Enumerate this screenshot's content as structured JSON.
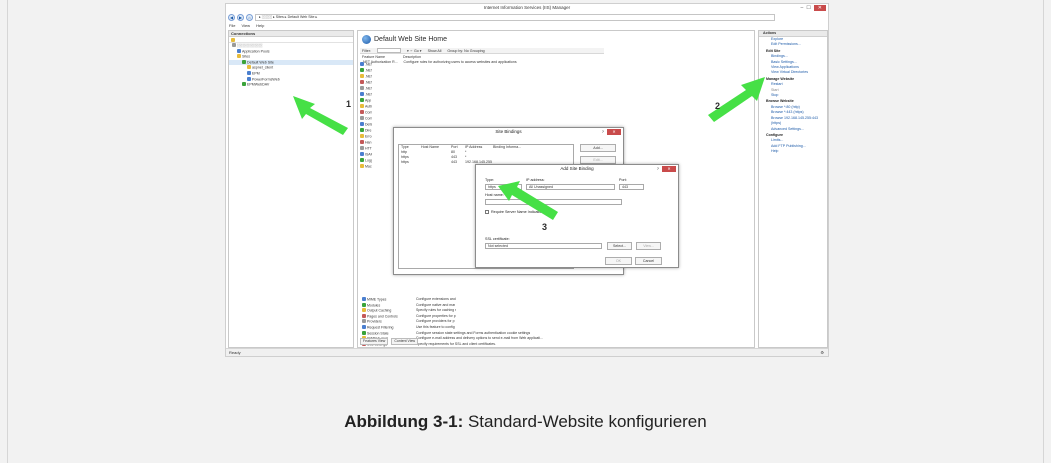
{
  "window": {
    "title": "Internet Information Services (IIS) Manager",
    "min": "‒",
    "max": "☐",
    "close": "✕"
  },
  "addressbar": {
    "path": "▸ ░░░░ ▸ Sites ▸ Default Web Site ▸"
  },
  "menu": {
    "items": [
      "File",
      "View",
      "Help"
    ]
  },
  "connections": {
    "header": "Connections",
    "tree": [
      {
        "label": "░░░░░░░░░░",
        "icon": "server-icon",
        "depth": 0
      },
      {
        "label": "Application Pools",
        "icon": "app-pool-icon",
        "depth": 1
      },
      {
        "label": "Sites",
        "icon": "folder-icon",
        "depth": 1
      },
      {
        "label": "Default Web Site",
        "icon": "globe-icon",
        "depth": 2
      },
      {
        "label": "aspnet_client",
        "icon": "folder-icon",
        "depth": 3
      },
      {
        "label": "EPM",
        "icon": "app-icon",
        "depth": 3
      },
      {
        "label": "PowerFormsWeb",
        "icon": "app-icon",
        "depth": 3
      },
      {
        "label": "EPMWebDAV",
        "icon": "globe-icon",
        "depth": 2
      }
    ]
  },
  "center": {
    "title": "Default Web Site Home",
    "filter_label": "Filter:",
    "go": "▾ ☞ Go ▾",
    "show_all": "Show All",
    "group_by": "Group by: No Grouping",
    "col_name": "Feature Name",
    "col_desc": "Description",
    "top_row_name": ".NET Authorization R...",
    "top_row_desc": "Configure rules for authorizing users to access websites and applications",
    "side_features": [
      ".NET",
      ".NET",
      ".NET",
      ".NET",
      ".NET",
      ".NET",
      "App",
      "Auth",
      "Com",
      "Com",
      "Defa",
      "Dire",
      "Erro",
      "Han",
      "HTT",
      "ISAP",
      "Logg",
      "Mac"
    ],
    "features": [
      {
        "name": "MIME Types",
        "desc": "Configure extensions and"
      },
      {
        "name": "Modules",
        "desc": "Configure native and mar"
      },
      {
        "name": "Output Caching",
        "desc": "Specify rules for caching r"
      },
      {
        "name": "Pages and Controls",
        "desc": "Configure properties for p"
      },
      {
        "name": "Providers",
        "desc": "Configure providers for p"
      },
      {
        "name": "Request Filtering",
        "desc": "Use this feature to config"
      },
      {
        "name": "Session State",
        "desc": "Configure session state settings and Forms authentication cookie settings"
      },
      {
        "name": "SMTP E-mail",
        "desc": "Configure e-mail address and delivery options to send e-mail from Web applicati..."
      },
      {
        "name": "SSL Settings",
        "desc": "Specify requirements for SSL and client certificates."
      }
    ],
    "tab_features": "Features View",
    "tab_content": "Content View"
  },
  "site_bindings": {
    "title": "Site Bindings",
    "help": "?",
    "close": "✕",
    "columns": [
      "Type",
      "Host Name",
      "Port",
      "IP Address",
      "Binding Informa..."
    ],
    "rows": [
      [
        "http",
        "",
        "80",
        "*",
        ""
      ],
      [
        "https",
        "",
        "443",
        "*",
        ""
      ],
      [
        "https",
        "",
        "443",
        "192.168.145.255",
        ""
      ]
    ],
    "btn_add": "Add...",
    "btn_edit": "Edit...",
    "btn_remove": "Remove",
    "btn_browse": "Browse"
  },
  "add_binding": {
    "title": "Add Site Binding",
    "help": "?",
    "close": "✕",
    "type_label": "Type:",
    "type_value": "https",
    "ip_label": "IP address:",
    "ip_value": "All Unassigned",
    "port_label": "Port:",
    "port_value": "443",
    "host_label": "Host name:",
    "host_value": "",
    "sni_label": "Require Server Name Indication",
    "ssl_label": "SSL certificate:",
    "ssl_value": "Not selected",
    "select": "Select...",
    "view": "View...",
    "ok": "OK",
    "cancel": "Cancel"
  },
  "actions": {
    "header": "Actions",
    "items": [
      {
        "text": "Explore",
        "kind": "lnk"
      },
      {
        "text": "Edit Permissions...",
        "kind": "lnk"
      },
      {
        "text": "Edit Site",
        "kind": "hdr"
      },
      {
        "text": "Bindings...",
        "kind": "lnk"
      },
      {
        "text": "Basic Settings...",
        "kind": "lnk"
      },
      {
        "text": "View Applications",
        "kind": "lnk"
      },
      {
        "text": "View Virtual Directories",
        "kind": "lnk"
      },
      {
        "text": "Manage Website",
        "kind": "hdr"
      },
      {
        "text": "Restart",
        "kind": "lnk"
      },
      {
        "text": "Start",
        "kind": "gray"
      },
      {
        "text": "Stop",
        "kind": "lnk"
      },
      {
        "text": "Browse Website",
        "kind": "hdr"
      },
      {
        "text": "Browse *:80 (http)",
        "kind": "lnk"
      },
      {
        "text": "Browse *:443 (https)",
        "kind": "lnk"
      },
      {
        "text": "Browse 192.168.145.255:443",
        "kind": "lnk"
      },
      {
        "text": "(https)",
        "kind": "lnk"
      },
      {
        "text": "Advanced Settings...",
        "kind": "lnk"
      },
      {
        "text": "Configure",
        "kind": "hdr"
      },
      {
        "text": "Limits...",
        "kind": "lnk"
      },
      {
        "text": "Add FTP Publishing...",
        "kind": "lnk"
      },
      {
        "text": "Help",
        "kind": "lnk"
      }
    ]
  },
  "status": {
    "text": "Ready"
  },
  "callouts": {
    "one": "1",
    "two": "2",
    "three": "3"
  },
  "caption": {
    "label": "Abbildung 3-1:",
    "text": " Standard-Website konfigurieren"
  },
  "colors": {
    "arrow": "#46e046",
    "close": "#c94b4b",
    "link": "#1c5aa8"
  }
}
